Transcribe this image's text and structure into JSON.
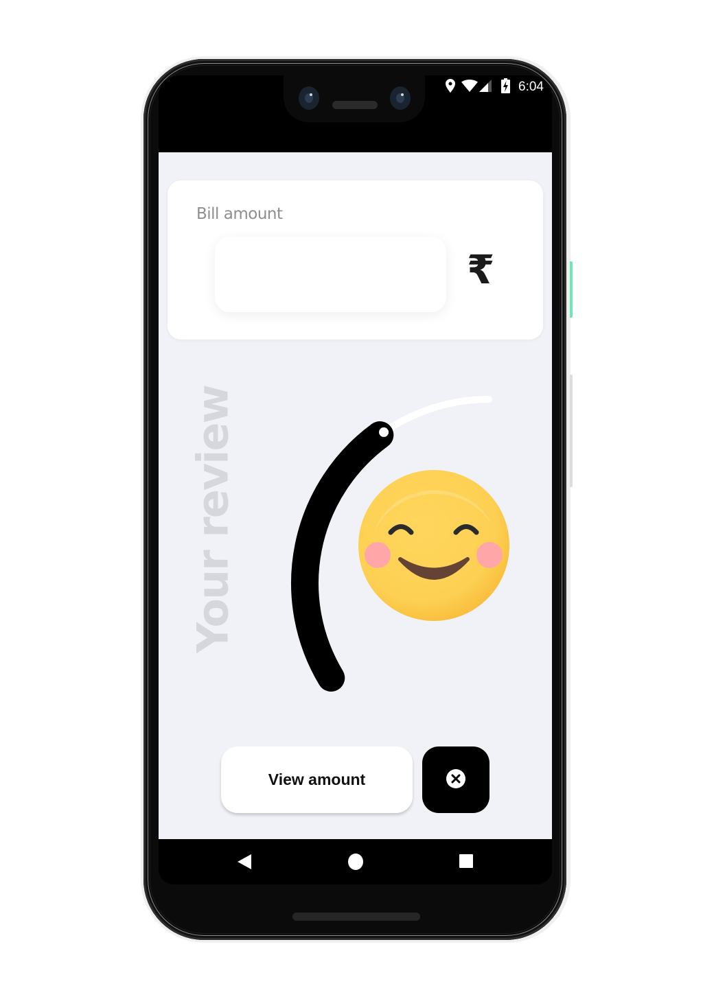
{
  "status_bar": {
    "time": "6:04",
    "icons": [
      "location-icon",
      "wifi-icon",
      "cellular-signal-icon",
      "battery-charging-icon"
    ]
  },
  "bill_card": {
    "label": "Bill amount",
    "input_value": "",
    "input_placeholder": "",
    "currency_symbol": "₹",
    "currency_icon": "rupee-icon"
  },
  "review": {
    "label": "Your review",
    "slider_value_fraction": 0.7,
    "emoji": "smiling-face-with-blush"
  },
  "actions": {
    "view_amount_label": "View amount",
    "close_icon": "close-circle-icon"
  },
  "nav_bar": {
    "icons": [
      "back-icon",
      "home-icon",
      "recents-icon"
    ]
  },
  "colors": {
    "screen_background": "#f1f2f7",
    "card_background": "#ffffff",
    "slider_fill": "#000000",
    "slider_track": "#ffffff",
    "review_label": "#d6d7dc",
    "emoji_face": "#fdd05a",
    "emoji_cheeks": "#ffa6a8",
    "emoji_mouth": "#644334",
    "power_button": "#6ee7b7"
  }
}
